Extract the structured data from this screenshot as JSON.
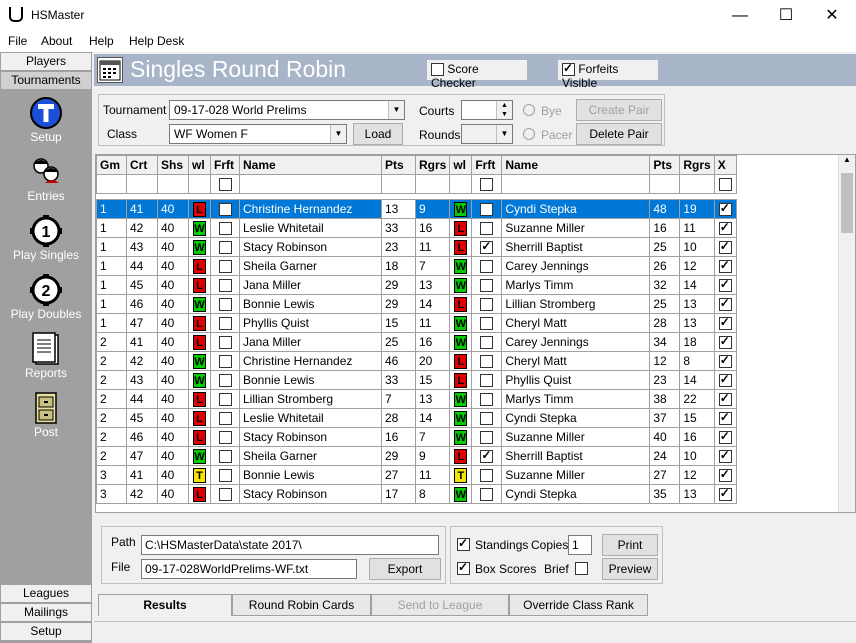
{
  "window": {
    "title": "HSMaster",
    "minimize": "—",
    "maximize": "☐",
    "close": "✕"
  },
  "menu": {
    "file": "File",
    "about": "About",
    "help": "Help",
    "helpdesk": "Help Desk"
  },
  "left": {
    "tab_players": "Players",
    "tab_tournaments": "Tournaments",
    "setup": "Setup",
    "entries": "Entries",
    "play_singles": "Play Singles",
    "play_doubles": "Play Doubles",
    "reports": "Reports",
    "post": "Post",
    "tab_leagues": "Leagues",
    "tab_mailings": "Mailings",
    "tab_setup": "Setup"
  },
  "header": {
    "title": "Singles Round Robin",
    "score_checker": "Score Checker",
    "score_checker_checked": false,
    "forfeits_visible": "Forfeits Visible",
    "forfeits_visible_checked": true
  },
  "form": {
    "tournament_label": "Tournament",
    "tournament_value": "09-17-028  World Prelims",
    "class_label": "Class",
    "class_value": "WF  Women F",
    "load": "Load",
    "courts_label": "Courts",
    "rounds_label": "Rounds",
    "bye": "Bye",
    "pacer": "Pacer",
    "create_pair": "Create Pair",
    "delete_pair": "Delete Pair"
  },
  "grid": {
    "headers": [
      "Gm",
      "Crt",
      "Shs",
      "wl",
      "Frft",
      "Name",
      "Pts",
      "Rgrs",
      "wl",
      "Frft",
      "Name",
      "Pts",
      "Rgrs",
      "X"
    ],
    "rows": [
      {
        "gm": "1",
        "crt": "41",
        "shs": "40",
        "wl1": "L",
        "f1": false,
        "name1": "Christine Hernandez",
        "pts1": "13",
        "rgrs1": "9",
        "wl2": "W",
        "f2": false,
        "name2": "Cyndi Stepka",
        "pts2": "48",
        "rgrs2": "19",
        "x": true
      },
      {
        "gm": "1",
        "crt": "42",
        "shs": "40",
        "wl1": "W",
        "f1": false,
        "name1": "Leslie Whitetail",
        "pts1": "33",
        "rgrs1": "16",
        "wl2": "L",
        "f2": false,
        "name2": "Suzanne Miller",
        "pts2": "16",
        "rgrs2": "11",
        "x": true
      },
      {
        "gm": "1",
        "crt": "43",
        "shs": "40",
        "wl1": "W",
        "f1": false,
        "name1": "Stacy Robinson",
        "pts1": "23",
        "rgrs1": "11",
        "wl2": "L",
        "f2": true,
        "name2": "Sherrill Baptist",
        "pts2": "25",
        "rgrs2": "10",
        "x": true
      },
      {
        "gm": "1",
        "crt": "44",
        "shs": "40",
        "wl1": "L",
        "f1": false,
        "name1": "Sheila Garner",
        "pts1": "18",
        "rgrs1": "7",
        "wl2": "W",
        "f2": false,
        "name2": "Carey Jennings",
        "pts2": "26",
        "rgrs2": "12",
        "x": true
      },
      {
        "gm": "1",
        "crt": "45",
        "shs": "40",
        "wl1": "L",
        "f1": false,
        "name1": "Jana Miller",
        "pts1": "29",
        "rgrs1": "13",
        "wl2": "W",
        "f2": false,
        "name2": "Marlys Timm",
        "pts2": "32",
        "rgrs2": "14",
        "x": true
      },
      {
        "gm": "1",
        "crt": "46",
        "shs": "40",
        "wl1": "W",
        "f1": false,
        "name1": "Bonnie Lewis",
        "pts1": "29",
        "rgrs1": "14",
        "wl2": "L",
        "f2": false,
        "name2": "Lillian Stromberg",
        "pts2": "25",
        "rgrs2": "13",
        "x": true
      },
      {
        "gm": "1",
        "crt": "47",
        "shs": "40",
        "wl1": "L",
        "f1": false,
        "name1": "Phyllis Quist",
        "pts1": "15",
        "rgrs1": "11",
        "wl2": "W",
        "f2": false,
        "name2": "Cheryl Matt",
        "pts2": "28",
        "rgrs2": "13",
        "x": true
      },
      {
        "gm": "2",
        "crt": "41",
        "shs": "40",
        "wl1": "L",
        "f1": false,
        "name1": "Jana Miller",
        "pts1": "25",
        "rgrs1": "16",
        "wl2": "W",
        "f2": false,
        "name2": "Carey Jennings",
        "pts2": "34",
        "rgrs2": "18",
        "x": true
      },
      {
        "gm": "2",
        "crt": "42",
        "shs": "40",
        "wl1": "W",
        "f1": false,
        "name1": "Christine Hernandez",
        "pts1": "46",
        "rgrs1": "20",
        "wl2": "L",
        "f2": false,
        "name2": "Cheryl Matt",
        "pts2": "12",
        "rgrs2": "8",
        "x": true
      },
      {
        "gm": "2",
        "crt": "43",
        "shs": "40",
        "wl1": "W",
        "f1": false,
        "name1": "Bonnie Lewis",
        "pts1": "33",
        "rgrs1": "15",
        "wl2": "L",
        "f2": false,
        "name2": "Phyllis Quist",
        "pts2": "23",
        "rgrs2": "14",
        "x": true
      },
      {
        "gm": "2",
        "crt": "44",
        "shs": "40",
        "wl1": "L",
        "f1": false,
        "name1": "Lillian Stromberg",
        "pts1": "7",
        "rgrs1": "13",
        "wl2": "W",
        "f2": false,
        "name2": "Marlys Timm",
        "pts2": "38",
        "rgrs2": "22",
        "x": true
      },
      {
        "gm": "2",
        "crt": "45",
        "shs": "40",
        "wl1": "L",
        "f1": false,
        "name1": "Leslie Whitetail",
        "pts1": "28",
        "rgrs1": "14",
        "wl2": "W",
        "f2": false,
        "name2": "Cyndi Stepka",
        "pts2": "37",
        "rgrs2": "15",
        "x": true
      },
      {
        "gm": "2",
        "crt": "46",
        "shs": "40",
        "wl1": "L",
        "f1": false,
        "name1": "Stacy Robinson",
        "pts1": "16",
        "rgrs1": "7",
        "wl2": "W",
        "f2": false,
        "name2": "Suzanne Miller",
        "pts2": "40",
        "rgrs2": "16",
        "x": true
      },
      {
        "gm": "2",
        "crt": "47",
        "shs": "40",
        "wl1": "W",
        "f1": false,
        "name1": "Sheila Garner",
        "pts1": "29",
        "rgrs1": "9",
        "wl2": "L",
        "f2": true,
        "name2": "Sherrill Baptist",
        "pts2": "24",
        "rgrs2": "10",
        "x": true
      },
      {
        "gm": "3",
        "crt": "41",
        "shs": "40",
        "wl1": "T",
        "f1": false,
        "name1": "Bonnie Lewis",
        "pts1": "27",
        "rgrs1": "11",
        "wl2": "T",
        "f2": false,
        "name2": "Suzanne Miller",
        "pts2": "27",
        "rgrs2": "12",
        "x": true
      },
      {
        "gm": "3",
        "crt": "42",
        "shs": "40",
        "wl1": "L",
        "f1": false,
        "name1": "Stacy Robinson",
        "pts1": "17",
        "rgrs1": "8",
        "wl2": "W",
        "f2": false,
        "name2": "Cyndi Stepka",
        "pts2": "35",
        "rgrs2": "13",
        "x": true
      }
    ]
  },
  "bottom": {
    "path_label": "Path",
    "path_value": "C:\\HSMasterData\\state 2017\\",
    "file_label": "File",
    "file_value": "09-17-028WorldPrelims-WF.txt",
    "export": "Export",
    "standings": "Standings",
    "standings_checked": true,
    "copies_label": "Copies",
    "copies_value": "1",
    "print": "Print",
    "box_scores": "Box Scores",
    "box_scores_checked": true,
    "brief": "Brief",
    "brief_checked": false,
    "preview": "Preview"
  },
  "tabs": {
    "results": "Results",
    "round_robin_cards": "Round Robin Cards",
    "send_to_league": "Send to League",
    "override_class_rank": "Override Class Rank"
  },
  "colors": {
    "win": "#00cc00",
    "loss": "#e00000",
    "tie": "#f4e400",
    "selection": "#0078d7"
  }
}
